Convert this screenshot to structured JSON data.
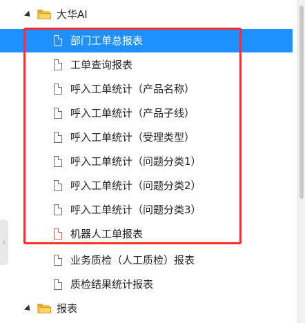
{
  "tree": {
    "folders": [
      {
        "label": "大华AI",
        "icon": "folder-open-icon",
        "expanded": true
      },
      {
        "label": "报表",
        "icon": "folder-open-icon",
        "expanded": true
      }
    ],
    "items": [
      {
        "label": "部门工单总报表",
        "icon": "document-icon",
        "selected": true
      },
      {
        "label": "工单查询报表",
        "icon": "document-icon"
      },
      {
        "label": "呼入工单统计（产品名称）",
        "icon": "document-icon"
      },
      {
        "label": "呼入工单统计（产品子线）",
        "icon": "document-icon"
      },
      {
        "label": "呼入工单统计（受理类型）",
        "icon": "document-icon"
      },
      {
        "label": "呼入工单统计（问题分类1）",
        "icon": "document-icon"
      },
      {
        "label": "呼入工单统计（问题分类2）",
        "icon": "document-icon"
      },
      {
        "label": "呼入工单统计（问题分类3）",
        "icon": "document-icon"
      },
      {
        "label": "机器人工单报表",
        "icon": "document-icon",
        "icon_color": "#d9534f"
      },
      {
        "label": "业务质检（人工质检）报表",
        "icon": "document-icon"
      },
      {
        "label": "质检结果统计报表",
        "icon": "document-icon"
      }
    ]
  },
  "colors": {
    "selection": "#1e90ff",
    "highlight_box": "#ff2a2a",
    "folder": "#f2c14e"
  }
}
